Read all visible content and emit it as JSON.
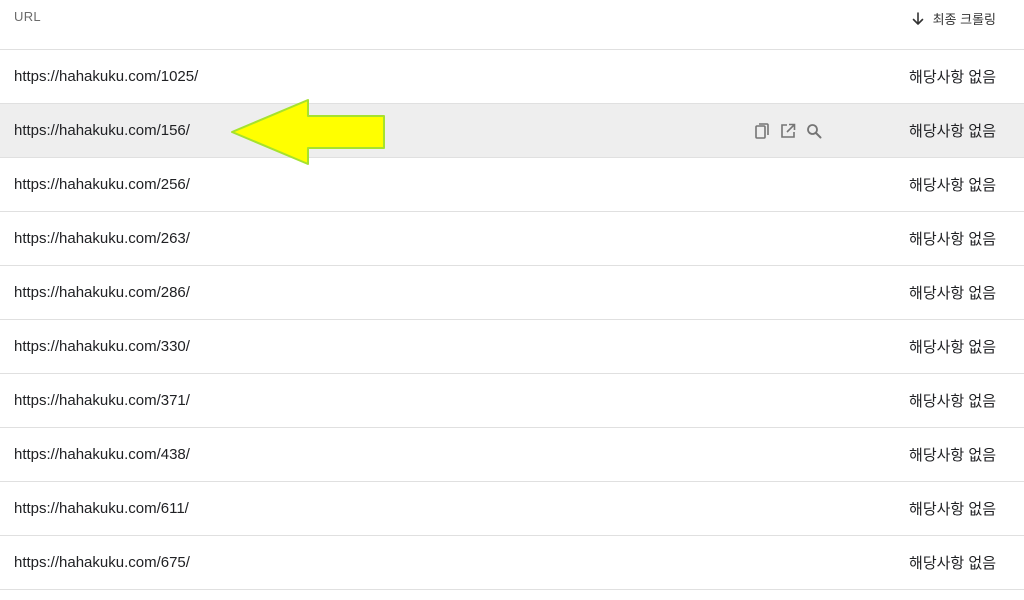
{
  "header": {
    "url_label": "URL",
    "last_crawl_label": "최종 크롤링",
    "sort_icon": "arrow-down-icon"
  },
  "row_actions": {
    "icons": [
      "copy-icon",
      "open-in-new-icon",
      "search-icon"
    ]
  },
  "annotation": {
    "arrow_color": "#ffff00",
    "arrow_stroke": "#a6e22e"
  },
  "rows": [
    {
      "url": "https://hahakuku.com/1025/",
      "status": "해당사항 없음"
    },
    {
      "url": "https://hahakuku.com/156/",
      "status": "해당사항 없음"
    },
    {
      "url": "https://hahakuku.com/256/",
      "status": "해당사항 없음"
    },
    {
      "url": "https://hahakuku.com/263/",
      "status": "해당사항 없음"
    },
    {
      "url": "https://hahakuku.com/286/",
      "status": "해당사항 없음"
    },
    {
      "url": "https://hahakuku.com/330/",
      "status": "해당사항 없음"
    },
    {
      "url": "https://hahakuku.com/371/",
      "status": "해당사항 없음"
    },
    {
      "url": "https://hahakuku.com/438/",
      "status": "해당사항 없음"
    },
    {
      "url": "https://hahakuku.com/611/",
      "status": "해당사항 없음"
    },
    {
      "url": "https://hahakuku.com/675/",
      "status": "해당사항 없음"
    }
  ]
}
